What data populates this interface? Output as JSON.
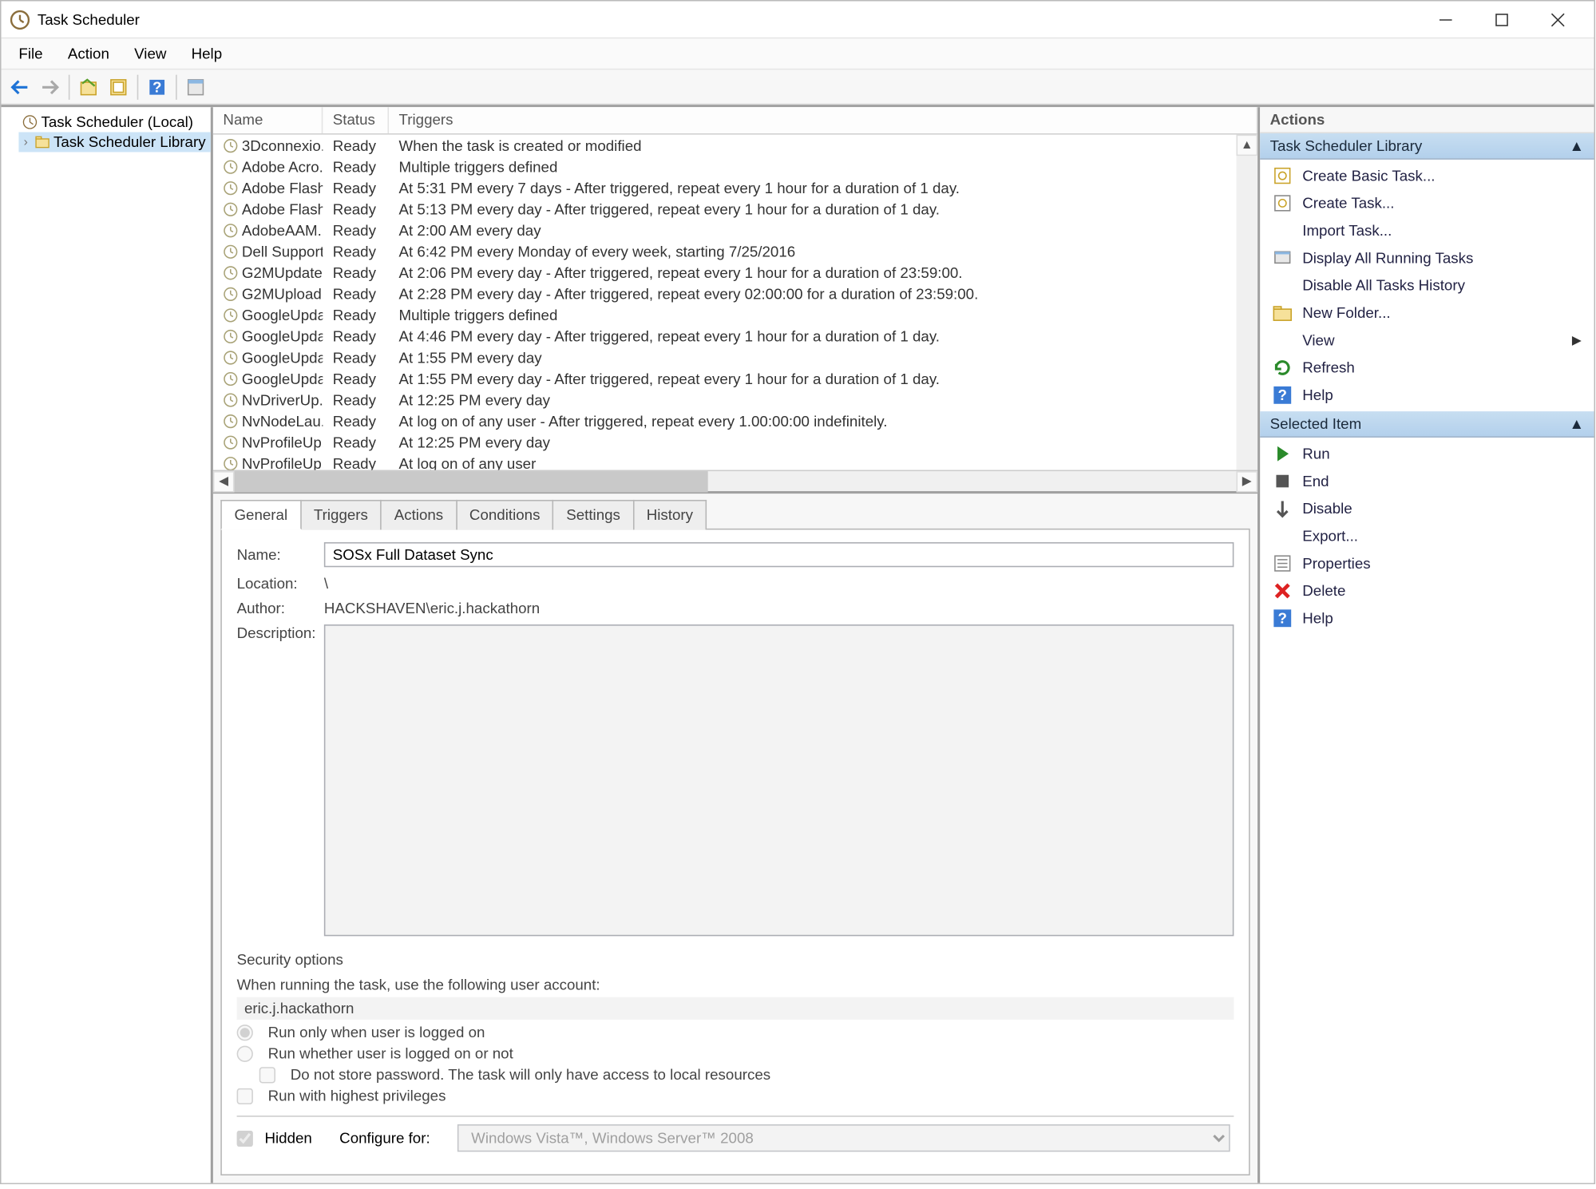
{
  "window": {
    "title": "Task Scheduler"
  },
  "menu": [
    "File",
    "Action",
    "View",
    "Help"
  ],
  "nav": {
    "root": "Task Scheduler (Local)",
    "child": "Task Scheduler Library"
  },
  "columns": [
    "Name",
    "Status",
    "Triggers"
  ],
  "tasks": [
    {
      "name": "3Dconnexio...",
      "status": "Ready",
      "trigger": "When the task is created or modified"
    },
    {
      "name": "Adobe Acro...",
      "status": "Ready",
      "trigger": "Multiple triggers defined"
    },
    {
      "name": "Adobe Flash...",
      "status": "Ready",
      "trigger": "At 5:31 PM every 7 days - After triggered, repeat every 1 hour for a duration of 1 day."
    },
    {
      "name": "Adobe Flash...",
      "status": "Ready",
      "trigger": "At 5:13 PM every day - After triggered, repeat every 1 hour for a duration of 1 day."
    },
    {
      "name": "AdobeAAM...",
      "status": "Ready",
      "trigger": "At 2:00 AM every day"
    },
    {
      "name": "Dell Support...",
      "status": "Ready",
      "trigger": "At 6:42 PM every Monday of every week, starting 7/25/2016"
    },
    {
      "name": "G2MUpdate...",
      "status": "Ready",
      "trigger": "At 2:06 PM every day - After triggered, repeat every 1 hour for a duration of 23:59:00."
    },
    {
      "name": "G2MUpload...",
      "status": "Ready",
      "trigger": "At 2:28 PM every day - After triggered, repeat every 02:00:00 for a duration of 23:59:00."
    },
    {
      "name": "GoogleUpda...",
      "status": "Ready",
      "trigger": "Multiple triggers defined"
    },
    {
      "name": "GoogleUpda...",
      "status": "Ready",
      "trigger": "At 4:46 PM every day - After triggered, repeat every 1 hour for a duration of 1 day."
    },
    {
      "name": "GoogleUpda...",
      "status": "Ready",
      "trigger": "At 1:55 PM every day"
    },
    {
      "name": "GoogleUpda...",
      "status": "Ready",
      "trigger": "At 1:55 PM every day - After triggered, repeat every 1 hour for a duration of 1 day."
    },
    {
      "name": "NvDriverUp...",
      "status": "Ready",
      "trigger": "At 12:25 PM every day"
    },
    {
      "name": "NvNodeLau...",
      "status": "Ready",
      "trigger": "At log on of any user - After triggered, repeat every 1.00:00:00 indefinitely."
    },
    {
      "name": "NvProfileUp...",
      "status": "Ready",
      "trigger": "At 12:25 PM every day"
    },
    {
      "name": "NvProfileUp...",
      "status": "Ready",
      "trigger": "At log on of any user"
    }
  ],
  "tabs": [
    "General",
    "Triggers",
    "Actions",
    "Conditions",
    "Settings",
    "History"
  ],
  "general": {
    "name_lbl": "Name:",
    "name": "SOSx Full Dataset Sync",
    "loc_lbl": "Location:",
    "location": "\\",
    "auth_lbl": "Author:",
    "author": "HACKSHAVEN\\eric.j.hackathorn",
    "desc_lbl": "Description:",
    "sec_title": "Security options",
    "sec_line1": "When running the task, use the following user account:",
    "sec_user": "eric.j.hackathorn",
    "sec_opt1": "Run only when user is logged on",
    "sec_opt2": "Run whether user is logged on or not",
    "sec_opt3": "Do not store password.  The task will only have access to local resources",
    "sec_opt4": "Run with highest privileges",
    "hidden": "Hidden",
    "cfg_lbl": "Configure for:",
    "cfg_val": "Windows Vista™, Windows Server™ 2008"
  },
  "actions": {
    "title": "Actions",
    "section1": "Task Scheduler Library",
    "items1": [
      {
        "icon": "basic",
        "label": "Create Basic Task..."
      },
      {
        "icon": "task",
        "label": "Create Task..."
      },
      {
        "icon": "",
        "label": "Import Task..."
      },
      {
        "icon": "display",
        "label": "Display All Running Tasks"
      },
      {
        "icon": "disable",
        "label": "Disable All Tasks History"
      },
      {
        "icon": "folder",
        "label": "New Folder..."
      },
      {
        "icon": "",
        "label": "View",
        "sub": true
      },
      {
        "icon": "refresh",
        "label": "Refresh"
      },
      {
        "icon": "help",
        "label": "Help"
      }
    ],
    "section2": "Selected Item",
    "items2": [
      {
        "icon": "run",
        "label": "Run"
      },
      {
        "icon": "end",
        "label": "End"
      },
      {
        "icon": "disable2",
        "label": "Disable"
      },
      {
        "icon": "",
        "label": "Export..."
      },
      {
        "icon": "props",
        "label": "Properties"
      },
      {
        "icon": "delete",
        "label": "Delete"
      },
      {
        "icon": "help",
        "label": "Help"
      }
    ]
  }
}
